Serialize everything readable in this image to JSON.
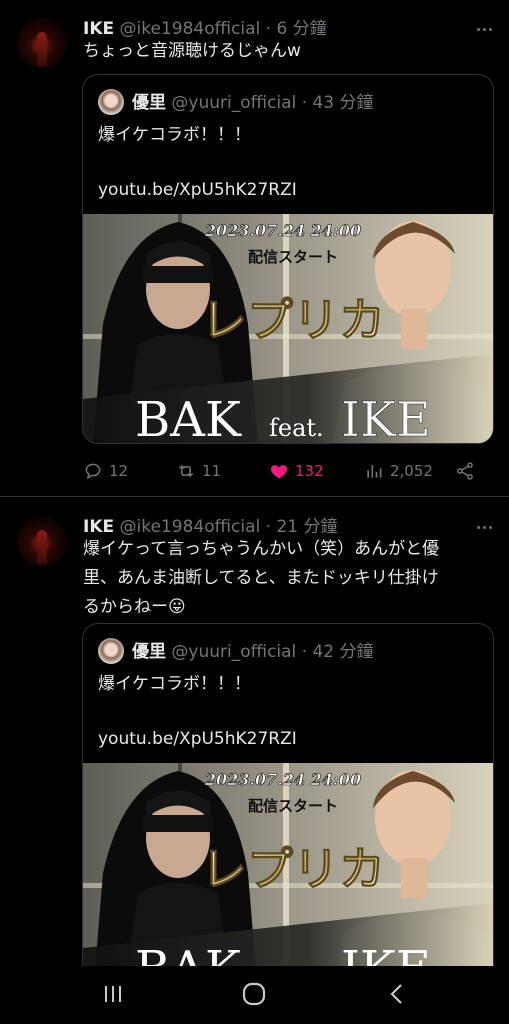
{
  "tweets": [
    {
      "author_name": "IKE",
      "handle": "@ike1984official",
      "time": "· 6 分鐘",
      "text": "ちょっと音源聴けるじゃんw",
      "quote": {
        "author_name": "優里",
        "handle": "@yuuri_official",
        "time": "· 43 分鐘",
        "line1": "爆イケコラボ！！！",
        "link": "youtu.be/XpU5hK27RZI"
      },
      "stats": {
        "replies": "12",
        "retweets": "11",
        "likes": "132",
        "views": "2,052"
      }
    },
    {
      "author_name": "IKE",
      "handle": "@ike1984official",
      "time": "· 21 分鐘",
      "text_line1": "爆イケって言っちゃうんかい（笑）あんがと優",
      "text_line2": "里、あんま油断してると、またドッキリ仕掛け",
      "text_line3": "るからねー😛",
      "quote": {
        "author_name": "優里",
        "handle": "@yuuri_official",
        "time": "· 42 分鐘",
        "line1": "爆イケコラボ！！！",
        "link": "youtu.be/XpU5hK27RZI"
      }
    }
  ],
  "media": {
    "date": "2023.07.24 24:00",
    "subtitle": "配信スタート",
    "title": "レプリカ",
    "artist_left": "BAK",
    "feat": "feat.",
    "artist_right": "IKE"
  },
  "icons": {
    "reply": "reply-icon",
    "retweet": "retweet-icon",
    "like": "heart-filled-icon",
    "views": "views-icon",
    "share": "share-icon",
    "more": "more-dots-icon",
    "nav": [
      "recent-apps-icon",
      "home-circle-icon",
      "back-chevron-icon"
    ]
  },
  "colors": {
    "like": "#f91880",
    "muted": "#71767b",
    "text": "#e7e9ea",
    "background": "#000000"
  }
}
